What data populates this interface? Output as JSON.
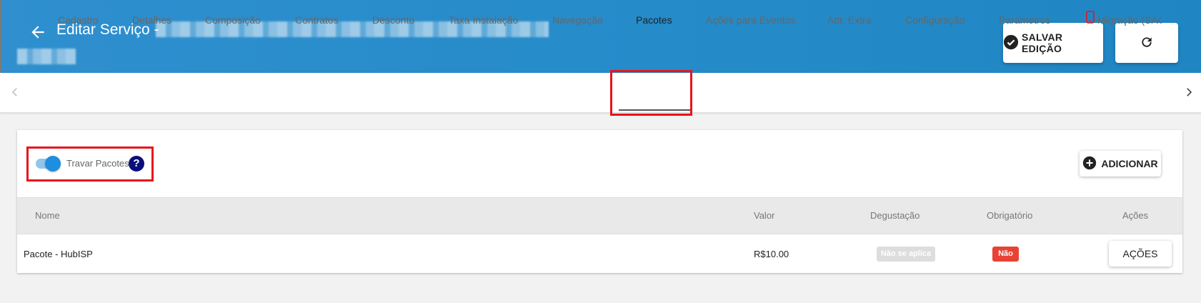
{
  "header": {
    "title": "Editar Serviço -",
    "save_label": "SALVAR EDIÇÃO",
    "icons": {
      "back": "arrow-left-icon",
      "save": "check-circle-icon",
      "refresh": "refresh-icon"
    },
    "color": "#258bc9"
  },
  "tabs": [
    {
      "label": "Cadastro"
    },
    {
      "label": "Detalhes"
    },
    {
      "label": "Composição"
    },
    {
      "label": "Contratos"
    },
    {
      "label": "Desconto"
    },
    {
      "label": "Taxa Instalação"
    },
    {
      "label": "Navegação"
    },
    {
      "label": "Pacotes",
      "active": true
    },
    {
      "label": "Ações para Eventos"
    },
    {
      "label": "Attr. Extra"
    },
    {
      "label": "Configuração"
    },
    {
      "label": "Parametros"
    },
    {
      "label": "Migração (SAC"
    }
  ],
  "panel": {
    "toggle_label": "Travar Pacotes",
    "toggle_on": true,
    "help_glyph": "?",
    "add_label": "ADICIONAR",
    "columns": [
      "Nome",
      "Valor",
      "Degustação",
      "Obrigatório",
      "Ações"
    ],
    "rows": [
      {
        "nome": "Pacote - HubISP",
        "valor": "R$10.00",
        "degustacao": "Não se aplica",
        "obrigatorio": "Não",
        "acoes": "AÇÕES"
      }
    ]
  },
  "colors": {
    "accent": "#1e8ee0",
    "highlight": "#e8141b",
    "danger": "#e84234"
  }
}
